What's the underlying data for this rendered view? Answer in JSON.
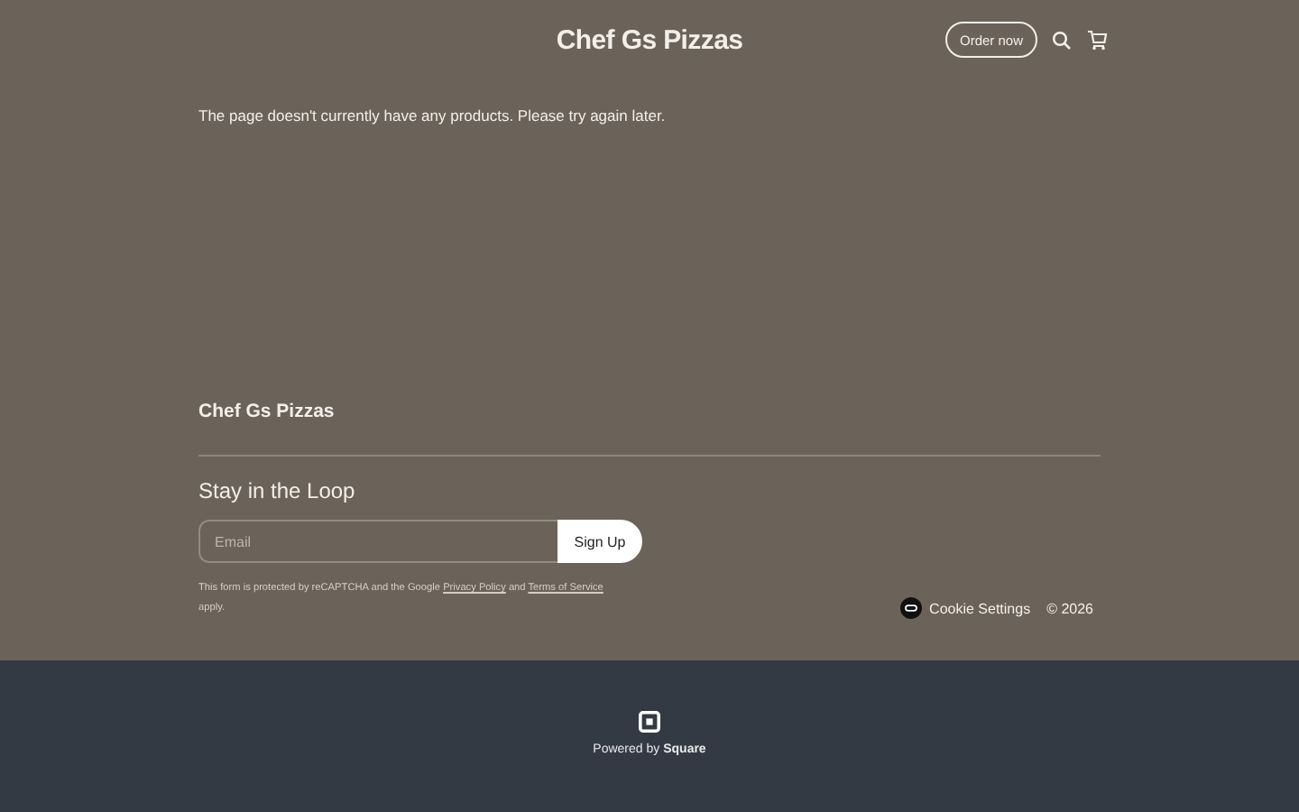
{
  "header": {
    "title": "Chef Gs Pizzas",
    "order_button": "Order now"
  },
  "message": "The page doesn't currently have any products. Please try again later.",
  "footer": {
    "brand": "Chef Gs Pizzas",
    "newsletter_title": "Stay in the Loop",
    "email": {
      "placeholder": "Email"
    },
    "signup_button": "Sign Up",
    "notice": {
      "before": "This form is protected by reCAPTCHA and the Google ",
      "privacy_link": "Privacy Policy",
      "middle": " and ",
      "terms_link": "Terms of Service",
      "after": " apply."
    },
    "cookie_settings": "Cookie Settings",
    "copyright": "© 2026"
  },
  "powered_by": "Powered by **Square**"
}
